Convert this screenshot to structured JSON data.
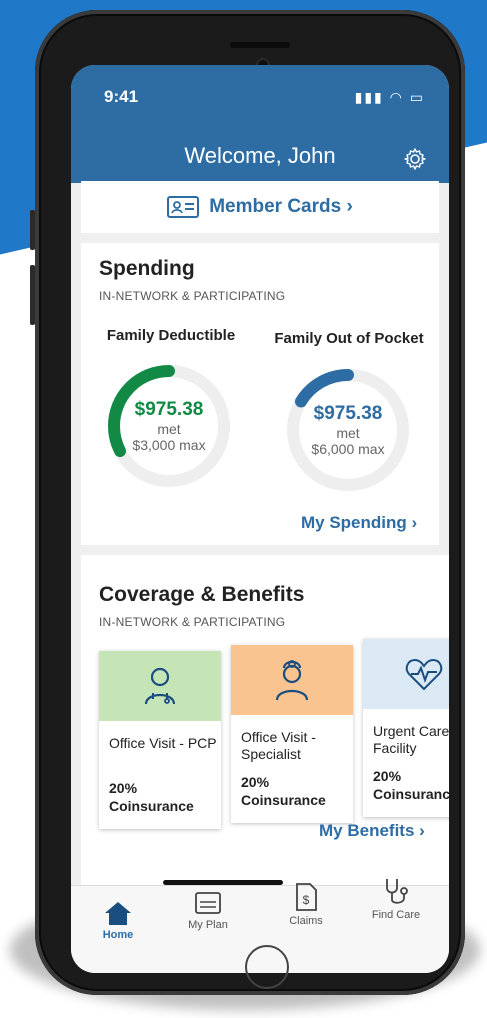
{
  "status": {
    "time": "9:41"
  },
  "header": {
    "title": "Welcome, John"
  },
  "member_cards": {
    "label": "Member Cards ›"
  },
  "spending": {
    "title": "Spending",
    "subtitle": "IN-NETWORK & PARTICIPATING",
    "deductible": {
      "label": "Family Deductible",
      "amount": "$975.38",
      "met": "met",
      "max": "$3,000 max",
      "progress": 0.325,
      "color": "#128a45"
    },
    "oop": {
      "label": "Family Out of Pocket",
      "amount": "$975.38",
      "met": "met",
      "max": "$6,000 max",
      "progress": 0.163,
      "color": "#2e6da4"
    },
    "link": "My Spending ›"
  },
  "coverage": {
    "title": "Coverage & Benefits",
    "subtitle": "IN-NETWORK & PARTICIPATING",
    "cards": [
      {
        "icon": "doctor-stethoscope-icon",
        "head_color": "#c6e5b6",
        "name": "Office Visit - PCP",
        "pct": "20%",
        "coins": "Coinsurance"
      },
      {
        "icon": "specialist-doctor-icon",
        "head_color": "#f9c48f",
        "name": "Office Visit - Specialist",
        "pct": "20%",
        "coins": "Coinsurance"
      },
      {
        "icon": "heartbeat-icon",
        "head_color": "#dbe9f5",
        "name": "Urgent Care - Facility",
        "pct": "20%",
        "coins": "Coinsurance"
      }
    ],
    "link": "My Benefits ›"
  },
  "tabs": [
    {
      "label": "Home",
      "icon": "home-icon",
      "active": true
    },
    {
      "label": "My Plan",
      "icon": "plan-card-icon",
      "active": false
    },
    {
      "label": "Claims",
      "icon": "claims-document-icon",
      "active": false
    },
    {
      "label": "Find Care",
      "icon": "stethoscope-icon",
      "active": false
    }
  ]
}
